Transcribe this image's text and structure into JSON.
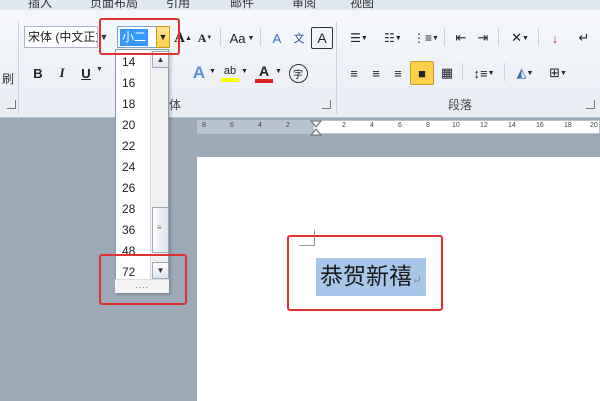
{
  "tabs": [
    "插入",
    "页面布局",
    "引用",
    "邮件",
    "审阅",
    "视图"
  ],
  "clipboard": {
    "format_painter_label": "刷"
  },
  "font": {
    "name_value": "宋体 (中文正文)",
    "size_value": "小二",
    "grow_label": "A",
    "shrink_label": "A",
    "change_case_label": "Aa",
    "clear_format_label": "A",
    "phonetic_label": "文",
    "border_label": "A",
    "bold_label": "B",
    "italic_label": "I",
    "underline_label": "U",
    "highlight_label": "ab",
    "font_color_label": "A",
    "enclose_label": "字",
    "group_label": "体",
    "size_options": [
      "14",
      "16",
      "18",
      "20",
      "22",
      "24",
      "26",
      "28",
      "36",
      "48",
      "72"
    ],
    "grip_label": "....",
    "highlight_color": "#ffff00",
    "font_color": "#e02020"
  },
  "paragraph": {
    "group_label": "段落"
  },
  "ruler": {
    "ticks": [
      "8",
      "6",
      "4",
      "2",
      "2",
      "4",
      "6",
      "8",
      "10",
      "12",
      "14",
      "16",
      "18",
      "20"
    ]
  },
  "document": {
    "heading_text": "恭贺新禧",
    "paragraph_mark": "↵"
  },
  "colors": {
    "annotation_red": "#e03030",
    "selection_blue": "#3399ff",
    "text_selection": "#a7c7ea"
  }
}
